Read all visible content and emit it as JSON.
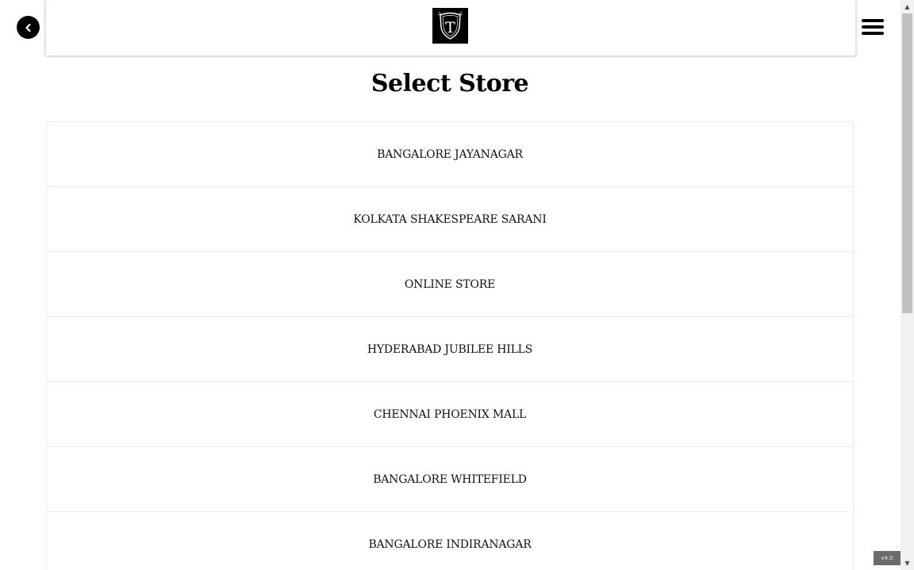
{
  "header": {
    "logo_letter": "T"
  },
  "page": {
    "title": "Select Store"
  },
  "stores": [
    {
      "label": "BANGALORE JAYANAGAR"
    },
    {
      "label": "KOLKATA SHAKESPEARE SARANI"
    },
    {
      "label": "ONLINE STORE"
    },
    {
      "label": "HYDERABAD JUBILEE HILLS"
    },
    {
      "label": "CHENNAI PHOENIX MALL"
    },
    {
      "label": "BANGALORE WHITEFIELD"
    },
    {
      "label": "BANGALORE INDIRANAGAR"
    }
  ],
  "footer": {
    "version": "v4.0"
  },
  "colors": {
    "background": "#ffffff",
    "text": "#000000",
    "logo_bg": "#000000",
    "border": "#ececec"
  },
  "icons": {
    "back": "chevron-left-icon",
    "menu": "hamburger-menu-icon",
    "logo": "shield-logo-icon"
  }
}
